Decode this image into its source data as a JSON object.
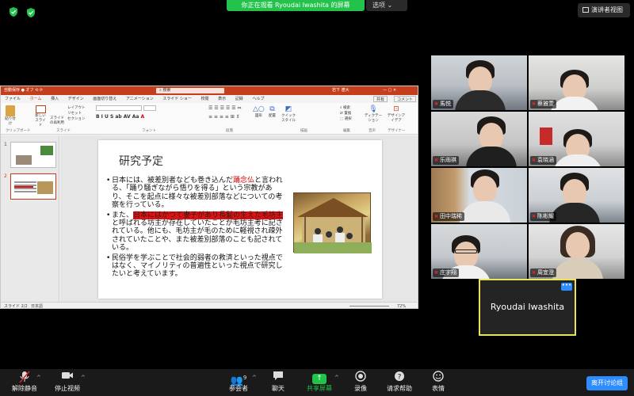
{
  "topbar": {
    "banner": "你正在观看 Ryoudai Iwashita 的屏幕",
    "options": "选项 ⌄",
    "speaker_view": "演讲者视图",
    "security_icon": "shield-check-icon",
    "security_color": "#23c24a"
  },
  "ppt": {
    "title_left": "自動保存 ●オフ  ⬚ ⟲ ⟳ ⊡ ⌄    岩下 遼大",
    "search": "検索",
    "title_right": "岩下 遼大",
    "tabs": [
      "ファイル",
      "ホーム",
      "挿入",
      "デザイン",
      "画面切り替え",
      "アニメーション",
      "スライド ショー",
      "校閲",
      "表示",
      "記録",
      "ヘルプ"
    ],
    "active_tab": "ホーム",
    "share": "共有",
    "comment": "コメント",
    "ribbon_groups": [
      "クリップボード",
      "スライド",
      "フォント",
      "段落",
      "描画",
      "編集",
      "音声",
      "デザイナー"
    ],
    "ribbon_labels": {
      "paste": "貼り付け",
      "new_slide": "新しいスライド",
      "reuse": "スライドの再利用",
      "layout": "レイアウト",
      "reset": "リセット",
      "section": "セクション",
      "shape": "図形",
      "arrange": "配置",
      "quick_style": "クイックスタイル",
      "search": "検索",
      "replace": "置換",
      "select": "選択",
      "dictate": "ディクテーション",
      "designer": "デザインアイデア"
    },
    "slide_numbers": [
      "1",
      "2"
    ],
    "status_left": "スライド 2/2",
    "status_lang": "日本語",
    "zoom": "72%"
  },
  "slide": {
    "title": "研究予定",
    "b1_pre": "日本には、被差別者なども巻き込んだ",
    "b1_red": "踊念仏",
    "b1_post": "と言われる、「踊り騒ぎながら悟りを得る」という宗教があり、そこを起点に様々な被差別部落などについての考察を行っている。",
    "b2_pre": "また、",
    "b2_hl": "日本にはかつて妻子があり長髪の生えた毛坊主",
    "b2_post": "と呼ばれる坊主が存在していたことが毛坊主考に記されている。他にも、毛坊主が毛のために軽視され疎外されていたことや、また被差別部落のことも記されている。",
    "b3": "民俗学を学ぶことで社会的弱者の救済といった視点ではなく、マイノリティの普遍性といった視点で研究したいと考えています。"
  },
  "participants": [
    {
      "name": "馬悦"
    },
    {
      "name": "蔡雅萱"
    },
    {
      "name": "乐雨祺"
    },
    {
      "name": "袁晓涵"
    },
    {
      "name": "田中瑞稀"
    },
    {
      "name": "陈彬耀"
    },
    {
      "name": "庄宇翔"
    },
    {
      "name": "周宜澄"
    }
  ],
  "active_speaker": {
    "name": "Ryoudai Iwashita",
    "more": "•••",
    "border_color": "#e8e25a"
  },
  "toolbar": {
    "unmute": "解除静音",
    "stop_video": "停止视频",
    "participants": "参会者",
    "participants_count": "9",
    "chat": "聊天",
    "share": "共享屏幕",
    "record": "录像",
    "help": "请求帮助",
    "reactions": "表情",
    "leave": "离开讨论组",
    "share_color": "#23c24a",
    "leave_color": "#2d8cff"
  }
}
